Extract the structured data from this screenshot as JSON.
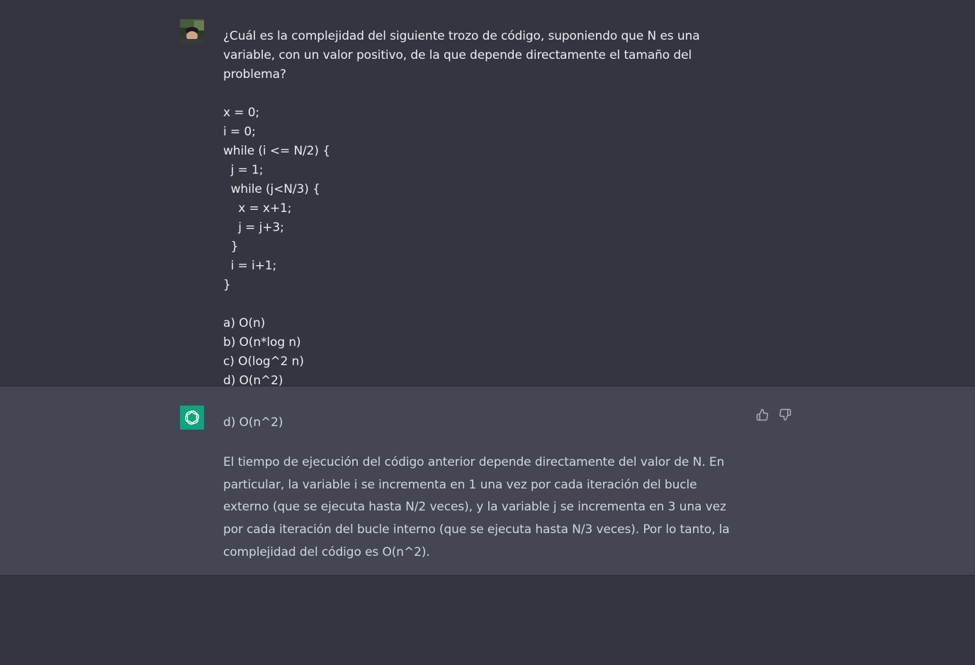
{
  "user_message": {
    "question": "¿Cuál es la complejidad del siguiente trozo de código, suponiendo que N es una variable, con un valor positivo, de la que depende directamente el tamaño del problema?",
    "code_lines": [
      "x = 0;",
      "i = 0;",
      "while (i <= N/2) {",
      "  j = 1;",
      "  while (j<N/3) {",
      "    x = x+1;",
      "    j = j+3;",
      "  }",
      "  i = i+1;",
      "}"
    ],
    "options": [
      "a) O(n)",
      "b) O(n*log n)",
      "c) O(log^2 n)",
      "d) O(n^2)"
    ]
  },
  "assistant_message": {
    "answer": "d) O(n^2)",
    "explanation": "El tiempo de ejecución del código anterior depende directamente del valor de N. En particular, la variable i se incrementa en 1 una vez por cada iteración del bucle externo (que se ejecuta hasta N/2 veces), y la variable j se incrementa en 3 una vez por cada iteración del bucle interno (que se ejecuta hasta N/3 veces). Por lo tanto, la complejidad del código es O(n^2)."
  },
  "icons": {
    "user_avatar": "user-avatar",
    "assistant_avatar": "openai-logo-icon",
    "thumbs_up": "thumbs-up-icon",
    "thumbs_down": "thumbs-down-icon"
  },
  "colors": {
    "background": "#343541",
    "assistant_background": "#444654",
    "accent": "#10a37f"
  }
}
